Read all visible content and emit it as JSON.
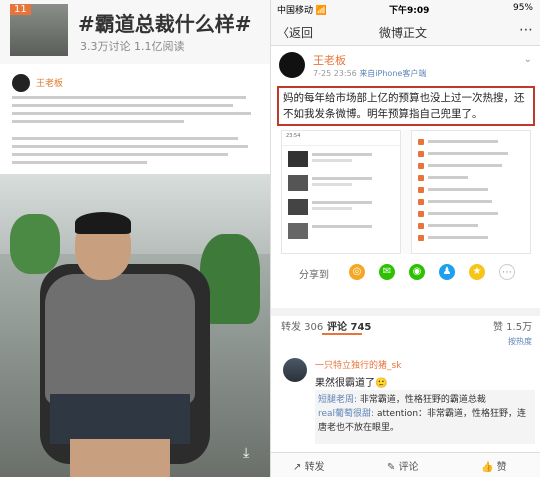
{
  "left": {
    "badge": "11",
    "topic_title": "#霸道总裁什么样#",
    "topic_stats": "3.3万讨论 1.1亿阅读",
    "post_author": "王老板"
  },
  "status": {
    "carrier": "中国移动 📶",
    "time": "下午9:09",
    "battery": "95%"
  },
  "nav": {
    "back": "〈返回",
    "title": "微博正文",
    "more": "⋯"
  },
  "post": {
    "author": "王老板",
    "date": "7-25 23:56",
    "source": "来自iPhone客户端",
    "text": "妈的每年给市场部上亿的预算也没上过一次热搜，还不如我发条微博。明年预算指自己兜里了。"
  },
  "embed": {
    "time": "23:54"
  },
  "share": {
    "label": "分享到"
  },
  "tabs": {
    "repost": "转发 306",
    "comment": "评论 745",
    "like": "赞 1.5万"
  },
  "sort_label": "按热度",
  "comment": {
    "user": "一只特立独行的猪_sk",
    "text": "果然很霸道了🙂",
    "reply1_user": "短腿老周:",
    "reply1_text": "非常霸道，性格狂野的霸道总裁",
    "reply2_user": "real葡萄很甜:",
    "reply2_text": "attention：非常霸道，性格狂野，连唐老也不放在眼里。"
  },
  "bottom": {
    "repost": "转发",
    "comment": "评论",
    "like": "赞"
  }
}
